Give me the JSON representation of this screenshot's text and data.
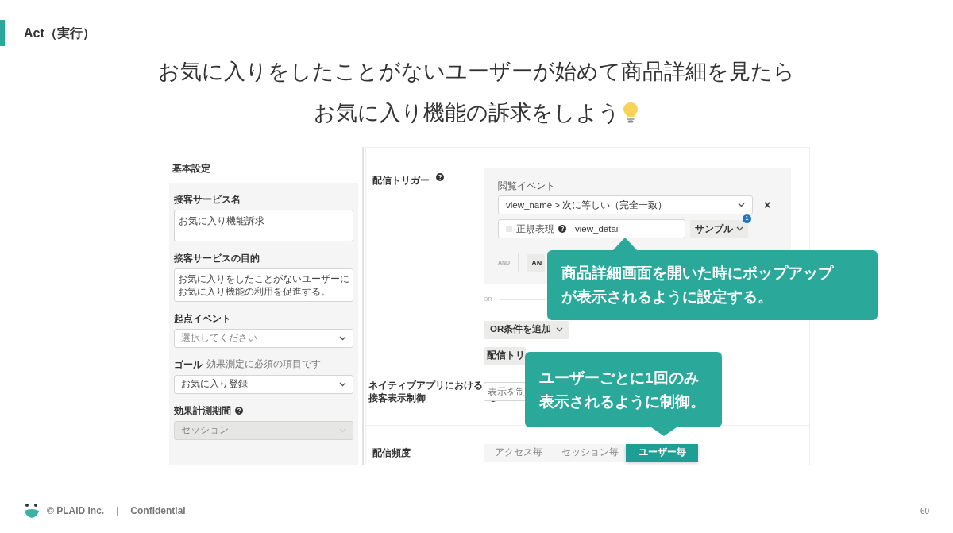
{
  "section_label": "Act（実行）",
  "headline": [
    "お気に入りをしたことがないユーザーが始めて商品詳細を見たら",
    "お気に入り機能の訴求をしよう"
  ],
  "screenshot": {
    "left_panel": {
      "title": "基本設定",
      "fields": [
        {
          "kind": "text",
          "label": "接客サービス名",
          "value": "お気に入り機能訴求"
        },
        {
          "kind": "textarea",
          "label": "接客サービスの目的",
          "value_lines": [
            "お気に入りをしたことがないユーザーに",
            "お気に入り機能の利用を促進する。"
          ]
        },
        {
          "kind": "select",
          "label": "起点イベント",
          "placeholder": "選択してください"
        },
        {
          "kind": "select",
          "label": "ゴール",
          "hint": "効果測定に必須の項目です",
          "value": "お気に入り登録"
        },
        {
          "kind": "select",
          "label": "効果計測期間",
          "value": "セッション",
          "help": true,
          "disabled": true
        }
      ]
    },
    "trigger": {
      "label": "配信トリガー",
      "event_label": "閲覧イベント",
      "condition": "view_name > 次に等しい（完全一致）",
      "remove": "×",
      "regex_label": "正規表現",
      "regex_checked": false,
      "value": "view_detail",
      "sample_button": "サンプル",
      "sample_badge": "1",
      "and_label": "AND",
      "and_button": "AN",
      "or_label": "OR",
      "or_button": "OR条件を追加",
      "add_trigger_button": "配信トリ"
    },
    "native": {
      "label_lines": [
        "ネイティブアプリにおける",
        "接客表示制御"
      ],
      "placeholder": "表示を制"
    },
    "frequency": {
      "label": "配信頻度",
      "options": [
        {
          "label": "アクセス毎",
          "selected": false
        },
        {
          "label": "セッション毎",
          "selected": false
        },
        {
          "label": "ユーザー毎",
          "selected": true
        }
      ]
    }
  },
  "callouts": [
    {
      "lines": [
        "商品詳細画面を開いた時にポップアップ",
        "が表示されるように設定する。"
      ]
    },
    {
      "lines": [
        "ユーザーごとに1回のみ",
        "表示されるように制御。"
      ]
    }
  ],
  "footer": {
    "copyright": "© PLAID Inc.",
    "separator": "|",
    "confidential": "Confidential",
    "page": "60"
  }
}
